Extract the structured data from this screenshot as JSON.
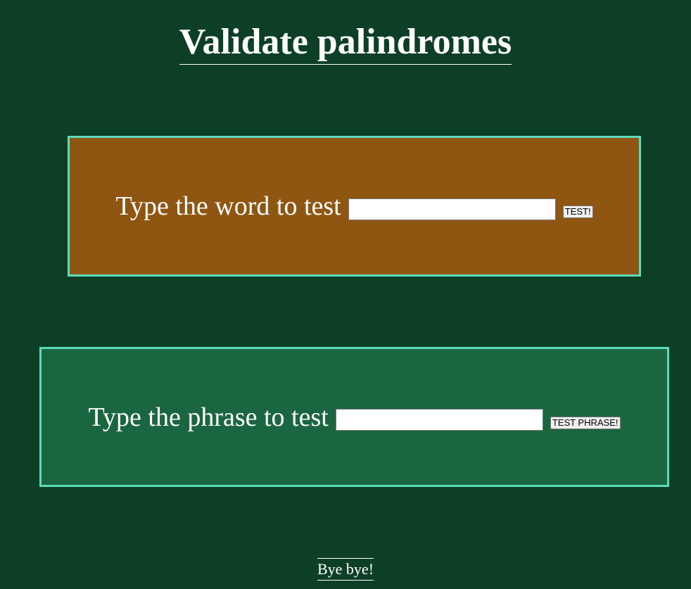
{
  "page": {
    "title": "Validate palindromes",
    "footer_text": "Bye bye!"
  },
  "word_panel": {
    "prompt": "Type the word to test",
    "input_value": "",
    "button_label": "TEST!"
  },
  "phrase_panel": {
    "prompt": "Type the phrase to test",
    "input_value": "",
    "button_label": "TEST PHRASE!"
  },
  "colors": {
    "background": "#0d3f27",
    "word_panel_bg": "#8f5612",
    "phrase_panel_bg": "#1a6640",
    "panel_border": "#5ddbbb",
    "text": "#ffffff"
  }
}
